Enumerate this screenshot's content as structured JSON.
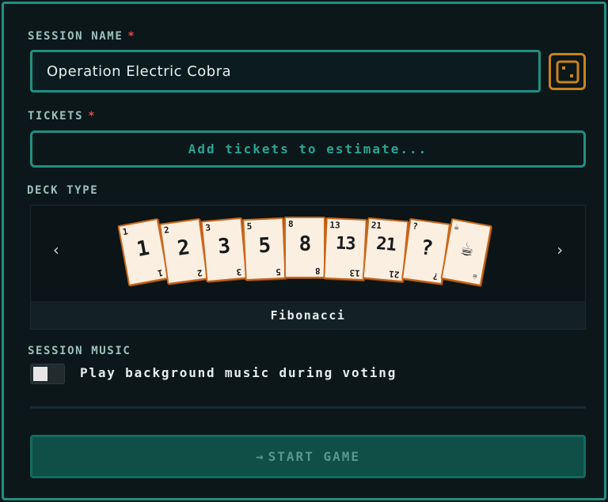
{
  "session_name": {
    "label": "SESSION NAME",
    "required_mark": "*",
    "value": "Operation Electric Cobra",
    "randomize_icon": "dice-icon"
  },
  "tickets": {
    "label": "TICKETS",
    "required_mark": "*",
    "placeholder": "Add tickets to estimate..."
  },
  "deck": {
    "label": "DECK TYPE",
    "selected": "Fibonacci",
    "prev_icon": "chevron-left-icon",
    "next_icon": "chevron-right-icon",
    "cards": [
      {
        "corner": "1",
        "face": "1"
      },
      {
        "corner": "2",
        "face": "2"
      },
      {
        "corner": "3",
        "face": "3"
      },
      {
        "corner": "5",
        "face": "5"
      },
      {
        "corner": "8",
        "face": "8"
      },
      {
        "corner": "13",
        "face": "13"
      },
      {
        "corner": "21",
        "face": "21"
      },
      {
        "corner": "?",
        "face": "?"
      },
      {
        "corner": "☕",
        "face": "☕"
      }
    ]
  },
  "music": {
    "label": "SESSION MUSIC",
    "toggle_label": "Play background music during voting",
    "enabled": false
  },
  "start": {
    "arrow": "→",
    "label": "START GAME"
  },
  "colors": {
    "accent": "#1f8f83",
    "dice": "#c9821f",
    "required": "#e8453d",
    "card_border": "#c9681c",
    "button_bg": "#0e4f48"
  }
}
